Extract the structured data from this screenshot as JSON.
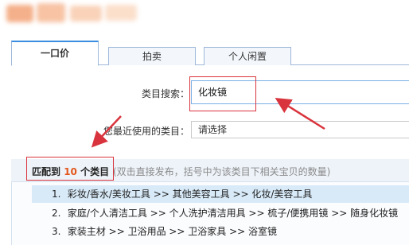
{
  "colors": {
    "accent": "#3a8de0",
    "annotation_red": "#d9343d",
    "match_count": "#e3561b",
    "selected_row": "#d8eaf8"
  },
  "tabs": [
    {
      "label": "一口价",
      "active": true
    },
    {
      "label": "拍卖",
      "active": false
    },
    {
      "label": "个人闲置",
      "active": false
    }
  ],
  "form": {
    "category_search_label": "类目搜索：",
    "category_search_value": "化妆镜",
    "recent_label": "您最近使用的类目：",
    "recent_select_value": "请选择"
  },
  "matches": {
    "prefix": "匹配到",
    "count": "10",
    "suffix": "个类目",
    "hint": "(双击直接发布，括号中为该类目下相关宝贝的数量)",
    "results": [
      {
        "num": "1.",
        "path": "彩妆/香水/美妆工具 >> 其他美容工具 >> 化妆/美容工具",
        "selected": true
      },
      {
        "num": "2.",
        "path": "家庭/个人清洁工具 >> 个人洗护清洁用具 >> 梳子/便携用镜 >> 随身化妆镜",
        "selected": false
      },
      {
        "num": "3.",
        "path": "家装主材 >> 卫浴用品 >> 卫浴家具 >> 浴室镜",
        "selected": false
      }
    ]
  }
}
